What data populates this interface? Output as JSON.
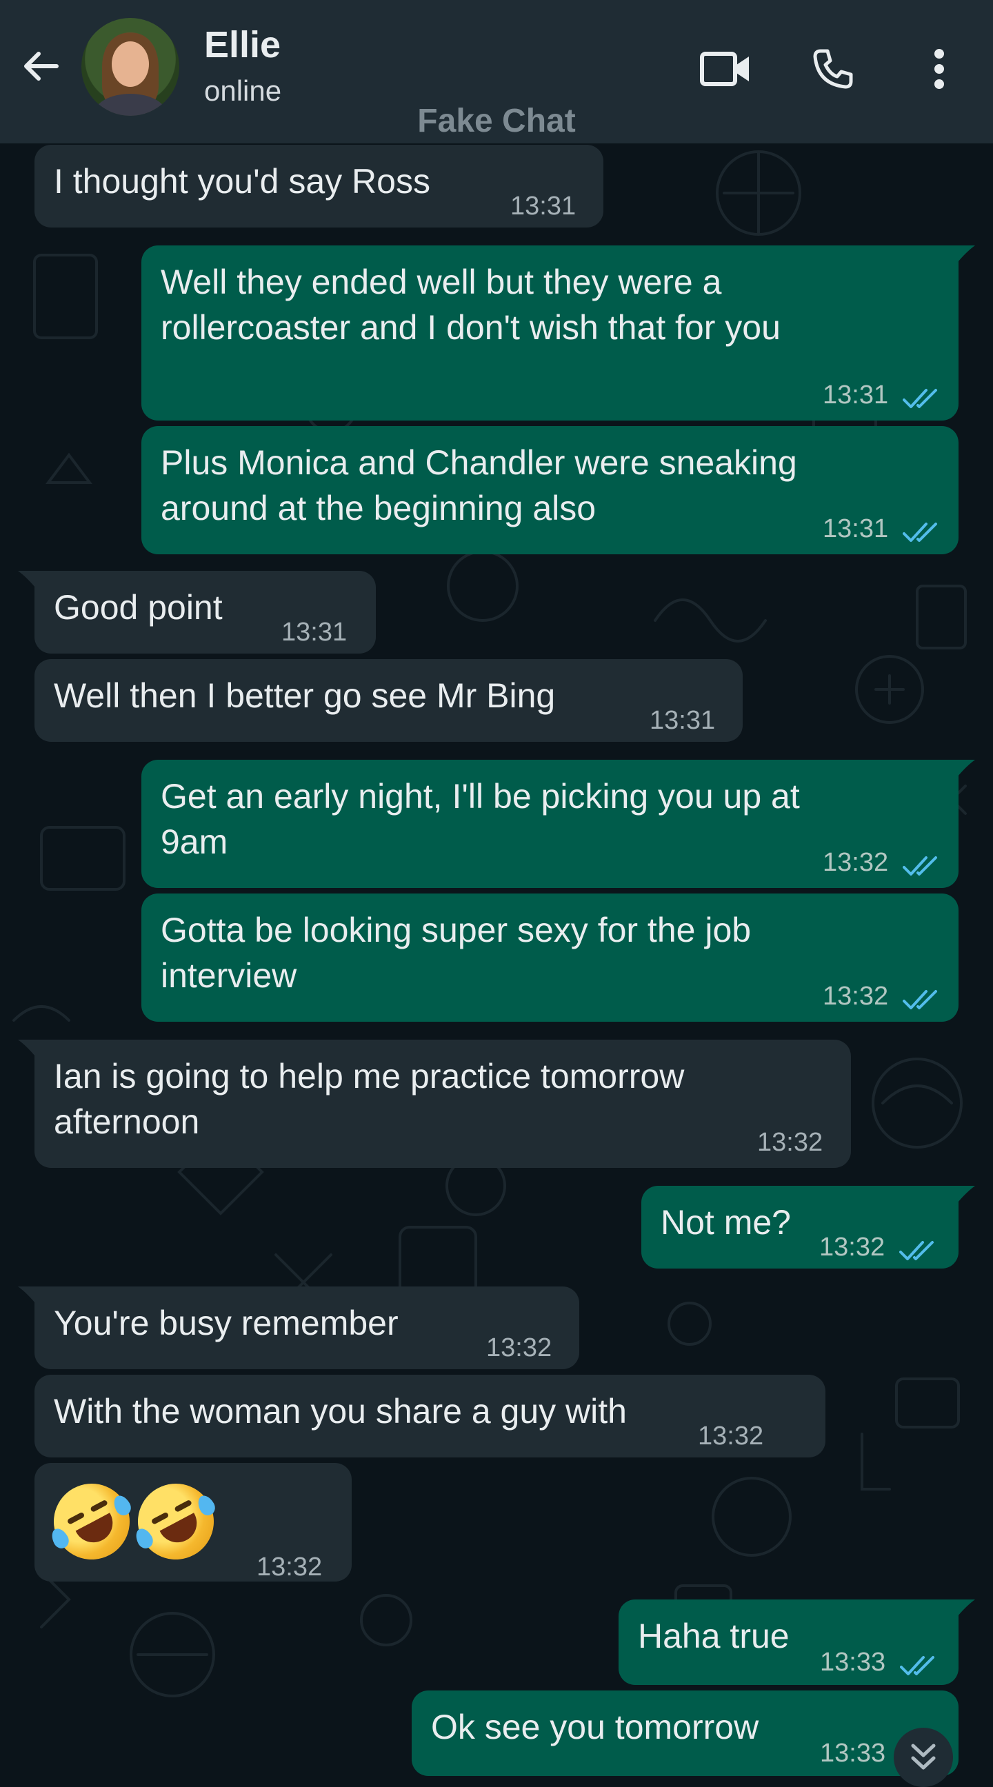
{
  "header": {
    "contact_name": "Ellie",
    "contact_status": "online",
    "watermark": "Fake Chat"
  },
  "icons": {
    "back": "arrow-back-icon",
    "video": "video-call-icon",
    "call": "phone-icon",
    "menu": "more-vert-icon",
    "read_receipt": "double-check-icon",
    "scroll_down": "chevron-double-down-icon"
  },
  "colors": {
    "background": "#0b141a",
    "header": "#1f2c34",
    "incoming_bubble": "#202c33",
    "outgoing_bubble": "#005c4b",
    "read_tick": "#53bdeb"
  },
  "messages": [
    {
      "dir": "in",
      "text": "I thought you'd say Ross",
      "time": "13:31"
    },
    {
      "dir": "out",
      "text": "Well they ended well but they were a\nrollercoaster and I don't wish that for you",
      "time": "13:31"
    },
    {
      "dir": "out",
      "text": "Plus Monica and Chandler were sneaking\naround at the beginning also",
      "time": "13:31"
    },
    {
      "dir": "in",
      "text": "Good point",
      "time": "13:31"
    },
    {
      "dir": "in",
      "text": "Well then I better go see Mr Bing",
      "time": "13:31"
    },
    {
      "dir": "out",
      "text": "Get an early night, I'll be picking you up at\n9am",
      "time": "13:32"
    },
    {
      "dir": "out",
      "text": "Gotta be looking super sexy for the job\ninterview",
      "time": "13:32"
    },
    {
      "dir": "in",
      "text": "Ian is going to help me practice tomorrow\nafternoon",
      "time": "13:32"
    },
    {
      "dir": "out",
      "text": "Not me?",
      "time": "13:32"
    },
    {
      "dir": "in",
      "text": "You're busy remember",
      "time": "13:32"
    },
    {
      "dir": "in",
      "text": "With the woman you share a guy with",
      "time": "13:32"
    },
    {
      "dir": "in",
      "text": "🤣🤣",
      "emoji": "rolling-on-floor-laughing",
      "time": "13:32"
    },
    {
      "dir": "out",
      "text": "Haha true",
      "time": "13:33"
    },
    {
      "dir": "out",
      "text": "Ok see you tomorrow",
      "time": "13:33"
    }
  ]
}
